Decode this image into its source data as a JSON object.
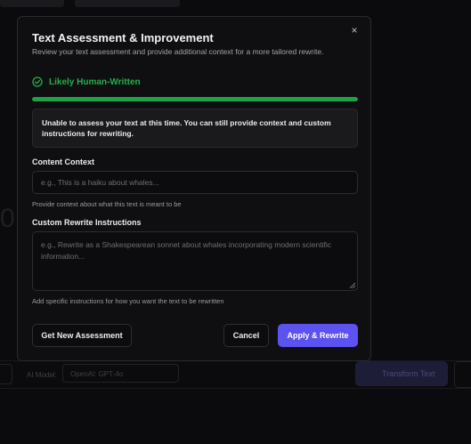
{
  "modal": {
    "title": "Text Assessment & Improvement",
    "subtitle": "Review your text assessment and provide additional context for a more tailored rewrite.",
    "close_label": "×",
    "verdict": {
      "label": "Likely Human-Written",
      "color": "#22b04a",
      "icon": "check-circle-icon",
      "progress": 1.0
    },
    "notice": "Unable to assess your text at this time. You can still provide context and custom instructions for rewriting.",
    "content_context": {
      "label": "Content Context",
      "value": "",
      "placeholder": "e.g., This is a haiku about whales...",
      "help": "Provide context about what this text is meant to be"
    },
    "rewrite_instructions": {
      "label": "Custom Rewrite Instructions",
      "value": "",
      "placeholder": "e.g., Rewrite as a Shakespearean sonnet about whales incorporating modern scientific information...",
      "help": "Add specific instructions for how you want the text to be rewritten"
    },
    "buttons": {
      "new_assessment": "Get New Assessment",
      "cancel": "Cancel",
      "apply": "Apply & Rewrite"
    },
    "colors": {
      "primary": "#5b52f0",
      "success": "#22b04a"
    }
  },
  "background": {
    "ai_model_label": "AI Model:",
    "ai_model_value": "OpenAI: GPT-4o",
    "transform_button": "Transform Text"
  }
}
